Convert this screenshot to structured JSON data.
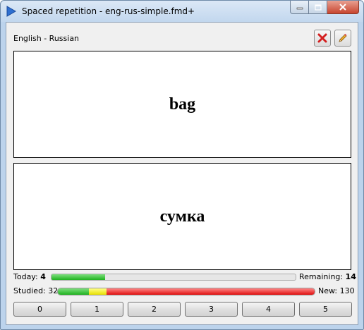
{
  "window": {
    "title": "Spaced repetition - eng-rus-simple.fmd+"
  },
  "toolbar": {
    "deck_name": "English - Russian",
    "delete_icon": "delete-x-icon",
    "edit_icon": "pencil-icon"
  },
  "card": {
    "front": "bag",
    "back": "сумка"
  },
  "stats": {
    "today_label": "Today:",
    "today_value": "4",
    "remaining_label": "Remaining:",
    "remaining_value": "14",
    "today_progress_fraction": 0.22,
    "studied_label": "Studied: 32",
    "new_label": "New: 130",
    "studied_progress": {
      "green_fraction": 0.12,
      "yellow_fraction": 0.07,
      "red_fraction": 0.81
    }
  },
  "grades": [
    "0",
    "1",
    "2",
    "3",
    "4",
    "5"
  ],
  "colors": {
    "progress_green": "#1fb21f",
    "progress_yellow": "#e8e000",
    "progress_red": "#e01010",
    "delete_red": "#d42020",
    "edit_orange": "#e09a20"
  }
}
